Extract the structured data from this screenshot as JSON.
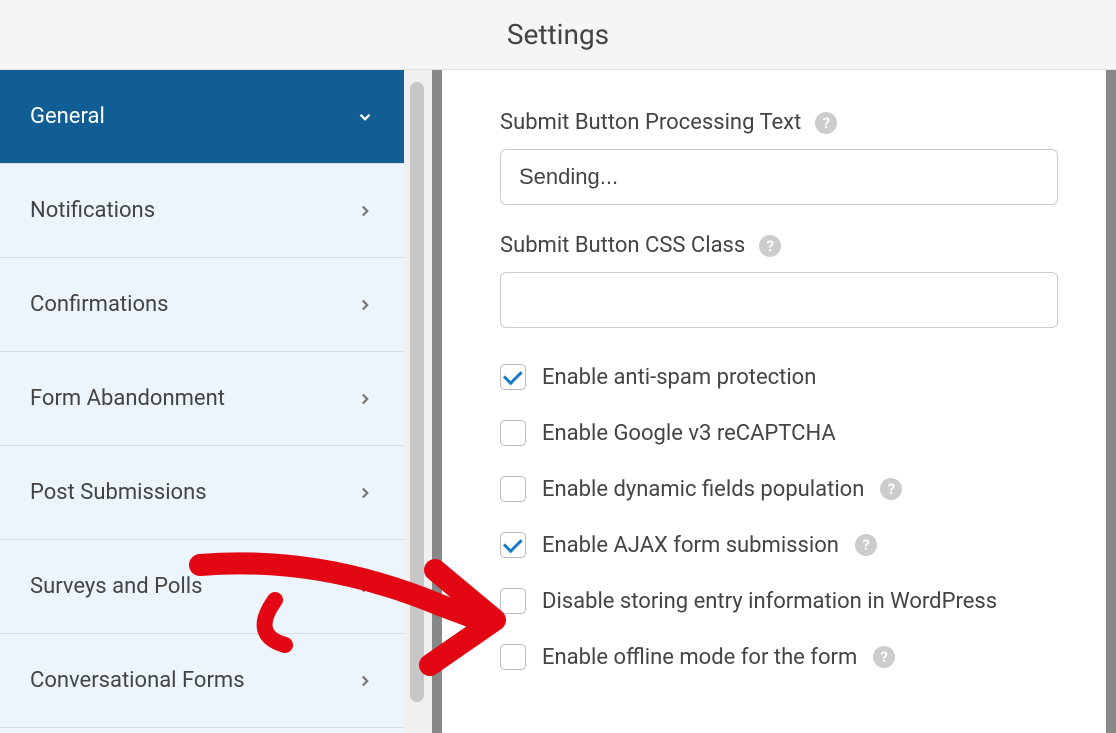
{
  "header": {
    "title": "Settings"
  },
  "sidebar": {
    "items": [
      {
        "label": "General",
        "active": true,
        "chevron": "down"
      },
      {
        "label": "Notifications",
        "active": false,
        "chevron": "right"
      },
      {
        "label": "Confirmations",
        "active": false,
        "chevron": "right"
      },
      {
        "label": "Form Abandonment",
        "active": false,
        "chevron": "right"
      },
      {
        "label": "Post Submissions",
        "active": false,
        "chevron": "right"
      },
      {
        "label": "Surveys and Polls",
        "active": false,
        "chevron": "right"
      },
      {
        "label": "Conversational Forms",
        "active": false,
        "chevron": "right"
      }
    ]
  },
  "main": {
    "processing_text_label": "Submit Button Processing Text",
    "processing_text_value": "Sending...",
    "css_class_label": "Submit Button CSS Class",
    "css_class_value": "",
    "checkboxes": [
      {
        "label": "Enable anti-spam protection",
        "checked": true,
        "help": false
      },
      {
        "label": "Enable Google v3 reCAPTCHA",
        "checked": false,
        "help": false
      },
      {
        "label": "Enable dynamic fields population",
        "checked": false,
        "help": true
      },
      {
        "label": "Enable AJAX form submission",
        "checked": true,
        "help": true
      },
      {
        "label": "Disable storing entry information in WordPress",
        "checked": false,
        "help": false
      },
      {
        "label": "Enable offline mode for the form",
        "checked": false,
        "help": true
      }
    ]
  },
  "help_glyph": "?"
}
